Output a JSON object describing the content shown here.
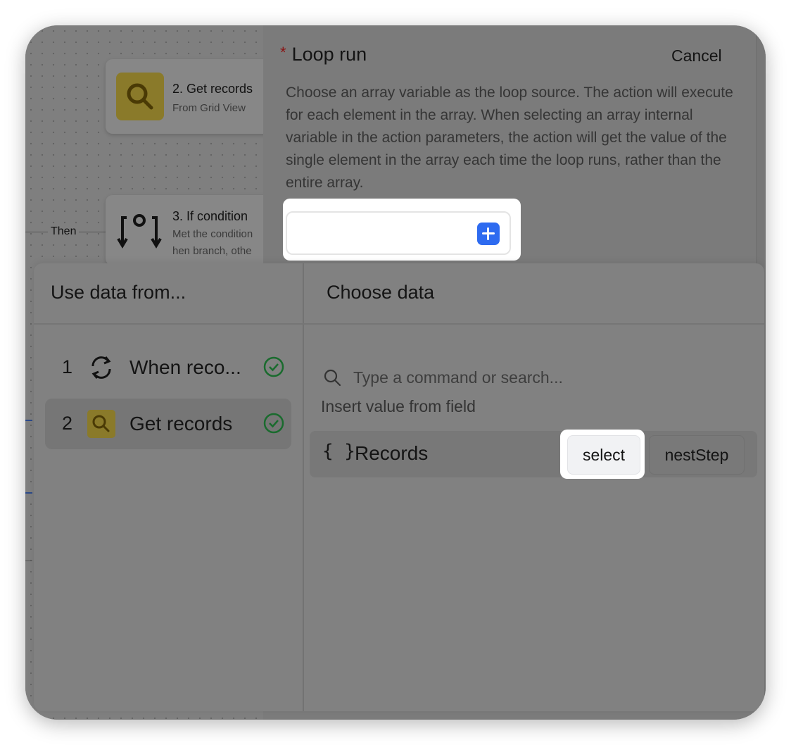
{
  "canvas": {
    "nodes": [
      {
        "title": "2. Get records",
        "subtitle": "From Grid View",
        "icon": "search-icon"
      },
      {
        "title": "3. If condition",
        "subtitle": "Met the condition",
        "subtitle2": "hen branch, othe",
        "icon": "branch-icon"
      }
    ],
    "edge_label": "Then"
  },
  "panel": {
    "required_mark": "*",
    "title": "Loop run",
    "cancel_label": "Cancel",
    "description": "Choose an array variable as the loop source. The action will execute for each element in the array. When selecting an array internal variable in the action parameters, the action will get the value of the single element in the array each time the loop runs, rather than the entire array.",
    "input_value": ""
  },
  "picker": {
    "left_header": "Use data from...",
    "right_header": "Choose data",
    "steps": [
      {
        "number": "1",
        "label": "When reco...",
        "icon": "refresh-icon",
        "status": "check-circle-icon"
      },
      {
        "number": "2",
        "label": "Get records",
        "icon": "search-icon",
        "status": "check-circle-icon"
      }
    ],
    "search_placeholder": "Type a command or search...",
    "section_label": "Insert value from field",
    "field": {
      "icon_text": "{ }",
      "label": "Records",
      "select_label": "select",
      "nest_label": "nestStep"
    }
  },
  "colors": {
    "accent_blue": "#2e6bf0",
    "check_green": "#1a6b2e",
    "node_icon_yellow": "#8a7a2a"
  }
}
